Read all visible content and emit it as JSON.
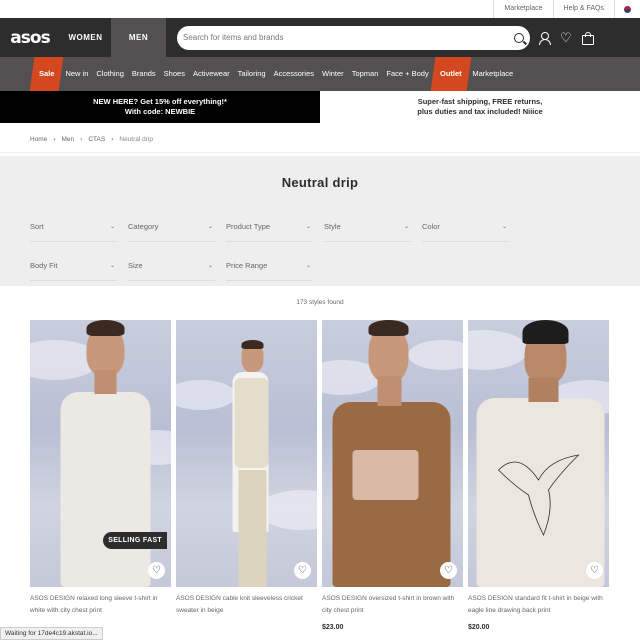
{
  "util_bar": {
    "marketplace": "Marketplace",
    "help": "Help & FAQs"
  },
  "header": {
    "logo": "asos",
    "tabs": [
      "WOMEN",
      "MEN"
    ],
    "search_placeholder": "Search for items and brands"
  },
  "nav": {
    "items": [
      "Sale",
      "New in",
      "Clothing",
      "Brands",
      "Shoes",
      "Activewear",
      "Tailoring",
      "Accessories",
      "Winter",
      "Topman",
      "Face + Body",
      "Outlet",
      "Marketplace"
    ],
    "highlight_color": "#d4481f"
  },
  "promo": {
    "left_line1": "NEW HERE? Get 15% off everything!*",
    "left_line2": "With code: NEWBIE",
    "right_line1": "Super-fast shipping, FREE returns,",
    "right_line2": "plus duties and tax included! Niiice"
  },
  "breadcrumb": [
    "Home",
    "Men",
    "CTAS",
    "Neutral drip"
  ],
  "page_title": "Neutral drip",
  "filters": [
    "Sort",
    "Category",
    "Product Type",
    "Style",
    "Color",
    "Body Fit",
    "Size",
    "Price Range"
  ],
  "results_count": "173 styles found",
  "products": [
    {
      "title": "ASOS DESIGN relaxed long sleeve t-shirt in white with city chest print",
      "price": "",
      "badge": "SELLING FAST",
      "top_color": "#ece9e4"
    },
    {
      "title": "ASOS DESIGN cable knit sleeveless cricket sweater in beige",
      "price": "",
      "badge": "",
      "top_color": "#e4ddcc"
    },
    {
      "title": "ASOS DESIGN oversized t-shirt in brown with city chest print",
      "price": "$23.00",
      "badge": "",
      "top_color": "#9a6a45"
    },
    {
      "title": "ASOS DESIGN standard fit t-shirt in beige with eagle line drawing back print",
      "price": "$20.00",
      "badge": "",
      "top_color": "#ebe6de"
    }
  ],
  "status_bar": "Waiting for 17de4c19.akstat.io..."
}
